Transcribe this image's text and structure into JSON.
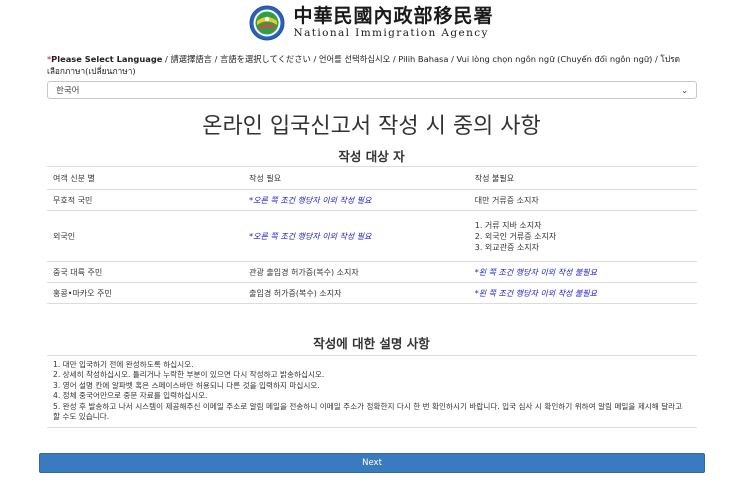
{
  "header": {
    "agency_zh": "中華民國內政部移民署",
    "agency_en": "National Immigration Agency"
  },
  "language": {
    "label_prefix": "*",
    "label_bold": "Please Select Language",
    "label_rest": " / 請選擇語言 / 言語を選択してください / 언어를 선택하십시오 / Pilih Bahasa / Vui lòng chọn ngôn ngữ (Chuyển đổi ngôn ngữ) / โปรดเลือกภาษา(เปลี่ยนภาษา)",
    "selected": "한국어"
  },
  "main_title": "온라인 입국신고서 작성 시 중의 사항",
  "target_section": {
    "title": "작성 대상 자",
    "columns": [
      "여객 신분 별",
      "작성 필요",
      "작성 불필요"
    ],
    "rows": [
      {
        "identity": "무호적 국민",
        "required": "*오른 쪽 조건 행당자 이외 작성 필요",
        "not_required": [
          "대만 거류증 소지자"
        ]
      },
      {
        "identity": "외국인",
        "required": "*오른 쪽 조건 행당자 이외 작성 필요",
        "not_required": [
          "1. 거류 지바 소지자",
          "2. 외국인 거류증 소지자",
          "3. 외교관증 소지자"
        ]
      },
      {
        "identity": "중국 대륙 주민",
        "required": "관광 출입경 허가증(복수) 소지자",
        "not_required": [
          "*왼 쪽 조건 행당자 이외 작성 불필요"
        ]
      },
      {
        "identity": "홍콩•마카오 주민",
        "required": "출입경 허가증(복수) 소지자",
        "not_required": [
          "*왼 쪽 조건 행당자 이외 작성 불필요"
        ]
      }
    ]
  },
  "instructions": {
    "title": "작성에 대한 설명 사항",
    "items": [
      "1. 대만 입국하기 전에 완성하도록 하십시오.",
      "2. 상세히 작성하십시오. 틀리거나 누락한 부분이 있으면 다시 작성하고 밝송하십시오.",
      "3. 영어 설명 칸에 알파벳 혹은 스페이스바만 허용되니 다른 것을 입력하지 마십시오.",
      "4. 정체 중국어만으로 중문 자료를 입력하십시오.",
      "5. 완성 후 발송하고 나서 시스템이 제공해주신 이메일 주소로 알림 메일을 전송하니 이메일 주소가 정확한지 다시 한 번 확인하시기 바랍니다. 입국 심사 시 확인하기 위하여 알림 메일을 제시해 달라고 할 수도 있습니다."
    ]
  },
  "next_button": "Next",
  "colors": {
    "accent": "#3a7bbf",
    "note_blue": "#1a1ad6",
    "required_mark": "#dd0000"
  }
}
